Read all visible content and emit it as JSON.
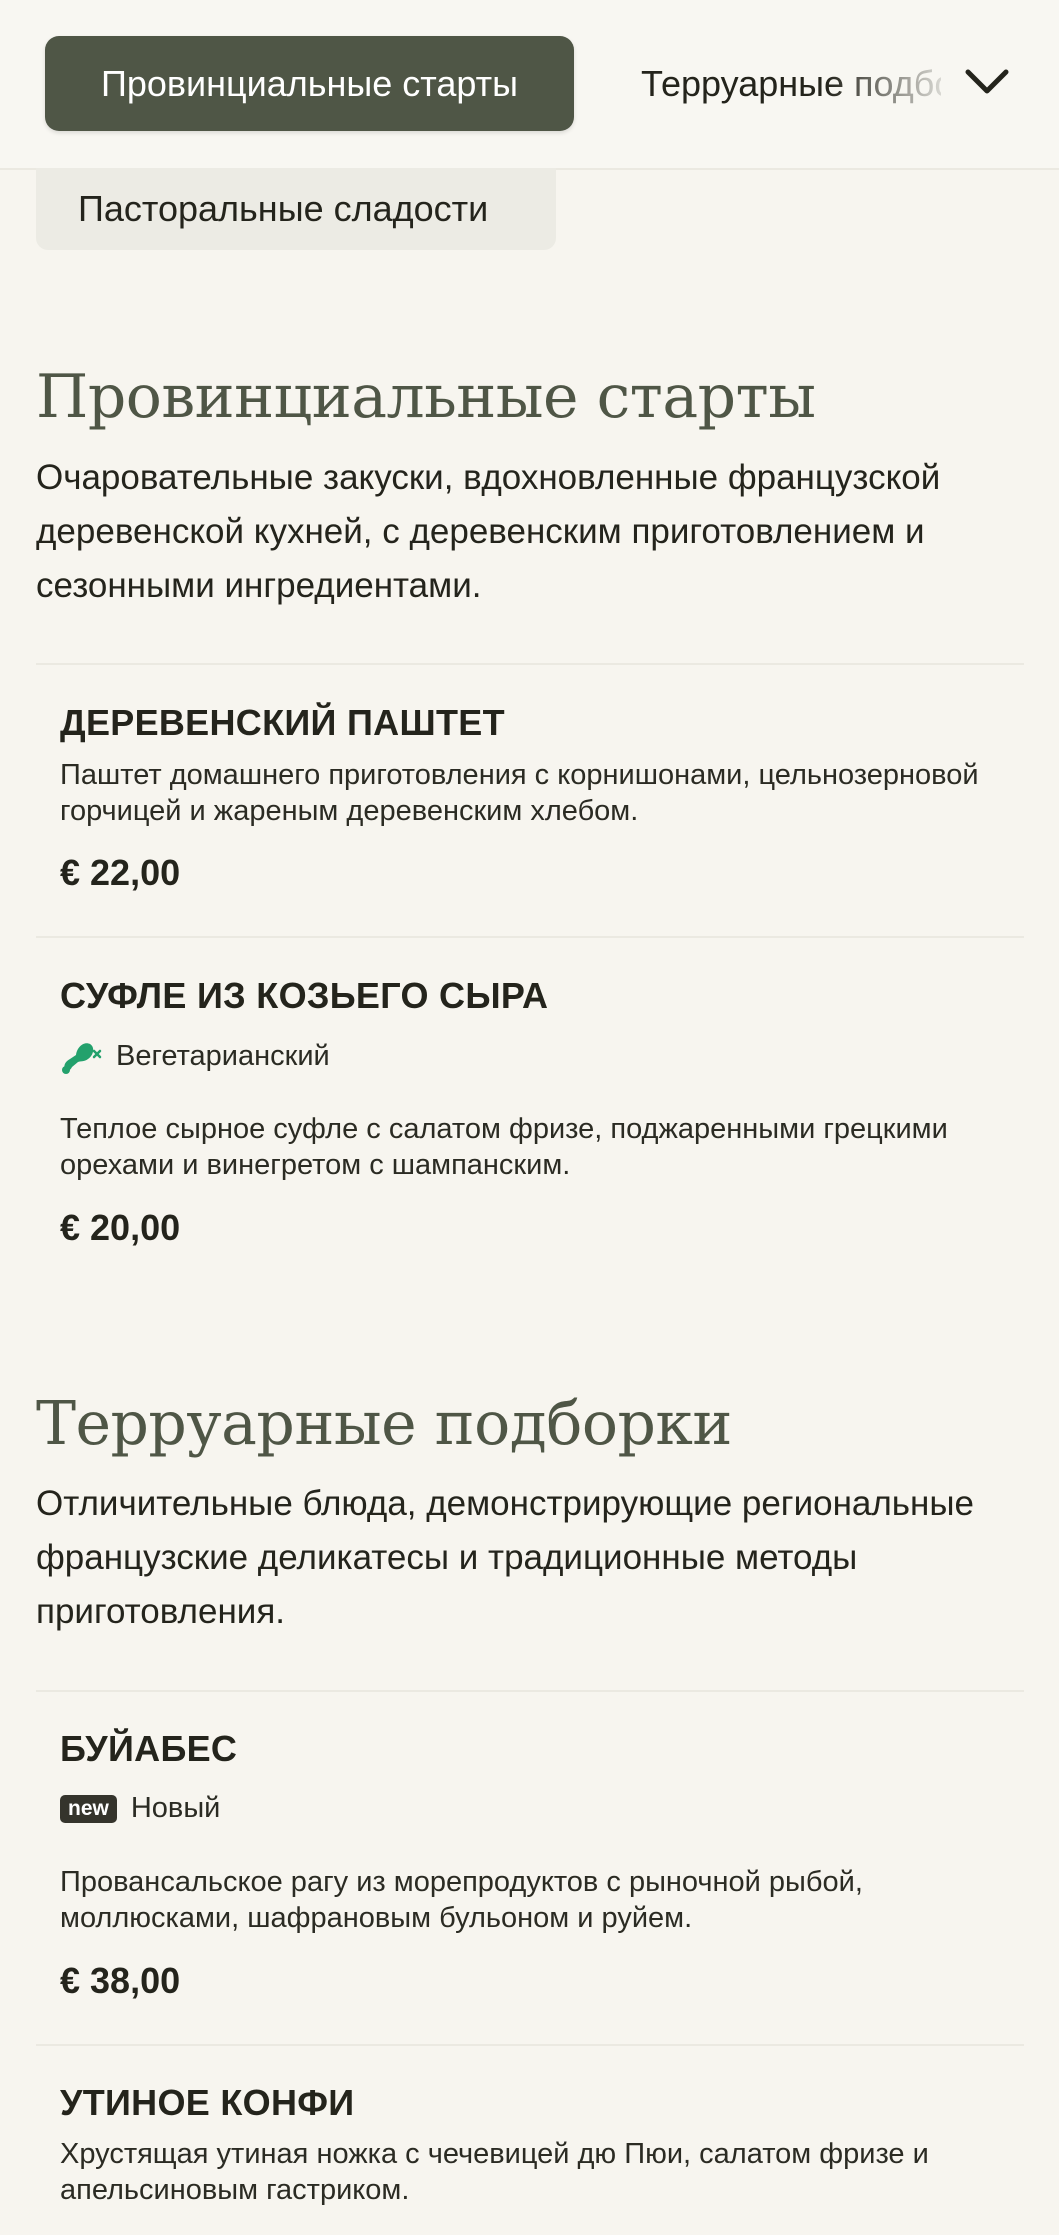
{
  "nav": {
    "active_label": "Провинциальные старты",
    "next_label": "Терруарные подборки",
    "third_label": "Пасторальные сладости",
    "expand_icon": "chevron-down-icon"
  },
  "sections": [
    {
      "title": "Провинциальные старты",
      "description": "Очаровательные закуски, вдохновленные французской деревенской кухней, с деревенским приготовлением и сезонными ингредиентами.",
      "items": [
        {
          "name": "ДЕРЕВЕНСКИЙ ПАШТЕТ",
          "description": "Паштет домашнего приготовления с корнишонами, цельнозерновой горчицей и жареным деревенским хлебом.",
          "price": "€ 22,00"
        },
        {
          "name": "СУФЛЕ ИЗ КОЗЬЕГО СЫРА",
          "tag": "Вегетарианский",
          "tag_icon": "vegetarian-drumstick-icon",
          "description": "Теплое сырное суфле с салатом фризе, поджаренными грецкими орехами и винегретом с шампанским.",
          "price": "€ 20,00"
        }
      ]
    },
    {
      "title": "Терруарные подборки",
      "description": "Отличительные блюда, демонстрирующие региональные французские деликатесы и традиционные методы приготовления.",
      "items": [
        {
          "name": "БУЙАБЕС",
          "badge": "new",
          "tag": "Новый",
          "description": "Провансальское рагу из морепродуктов с рыночной рыбой, моллюсками, шафрановым бульоном и руйем.",
          "price": "€ 38,00"
        },
        {
          "name": "УТИНОЕ КОНФИ",
          "description": "Хрустящая утиная ножка с чечевицей дю Пюи, салатом фризе и апельсиновым гастриком."
        }
      ]
    }
  ],
  "colors": {
    "background": "#f7f5ef",
    "accent": "#4f5646",
    "vegetarian_green": "#23a16c",
    "text": "#24241c"
  }
}
